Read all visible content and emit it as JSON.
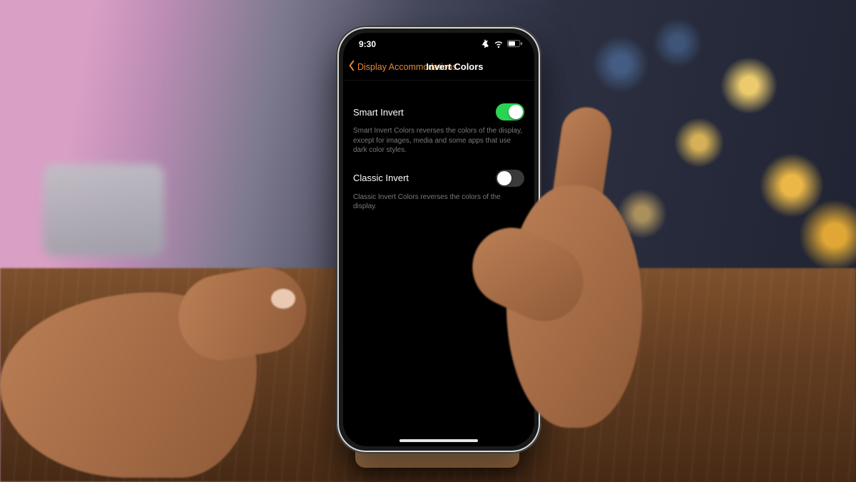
{
  "status": {
    "time": "9:30"
  },
  "nav": {
    "back_label": "Display Accommodations",
    "title": "Invert Colors"
  },
  "settings": {
    "smart_invert": {
      "label": "Smart Invert",
      "enabled": true,
      "description": "Smart Invert Colors reverses the colors of the display, except for images, media and some apps that use dark color styles."
    },
    "classic_invert": {
      "label": "Classic Invert",
      "enabled": false,
      "description": "Classic Invert Colors reverses the colors of the display."
    }
  }
}
